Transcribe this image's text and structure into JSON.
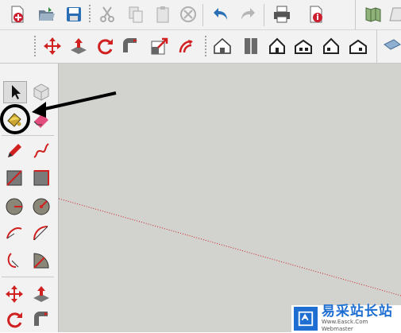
{
  "toolbar_main": {
    "icons": [
      "new-file-icon",
      "open-folder-icon",
      "save-icon",
      "cut-icon",
      "copy-icon",
      "paste-icon",
      "erase-icon",
      "undo-icon",
      "redo-icon",
      "print-icon",
      "model-info-icon",
      "map-icon",
      "layer-icon"
    ]
  },
  "toolbar_views": {
    "icons": [
      "move-icon",
      "push-pull-icon",
      "rotate-icon",
      "follow-me-icon",
      "scale-icon",
      "offset-icon",
      "iso-view-icon",
      "top-view-icon",
      "front-view-icon",
      "right-view-icon",
      "back-view-icon",
      "left-view-icon",
      "section-view-icon"
    ]
  },
  "left_tools": {
    "icons": [
      "select-arrow-icon",
      "component-icon",
      "paint-bucket-icon",
      "eraser-icon",
      "pencil-line-icon",
      "freehand-icon",
      "rectangle-icon",
      "rotated-rectangle-icon",
      "circle-icon",
      "polygon-icon",
      "arc-icon",
      "two-point-arc-icon",
      "three-point-arc-icon",
      "pie-icon",
      "move-icon",
      "push-pull-icon",
      "rotate-icon",
      "follow-me-icon"
    ]
  },
  "canvas": {
    "background": "#d2d2cf",
    "axis_color": "#cc2222"
  },
  "annotation": {
    "highlight": "paint-bucket-tool",
    "color": "#000000"
  },
  "watermark": {
    "title": "易采站长站",
    "subtitle": "Www.Easck.Com  Webmaster"
  }
}
